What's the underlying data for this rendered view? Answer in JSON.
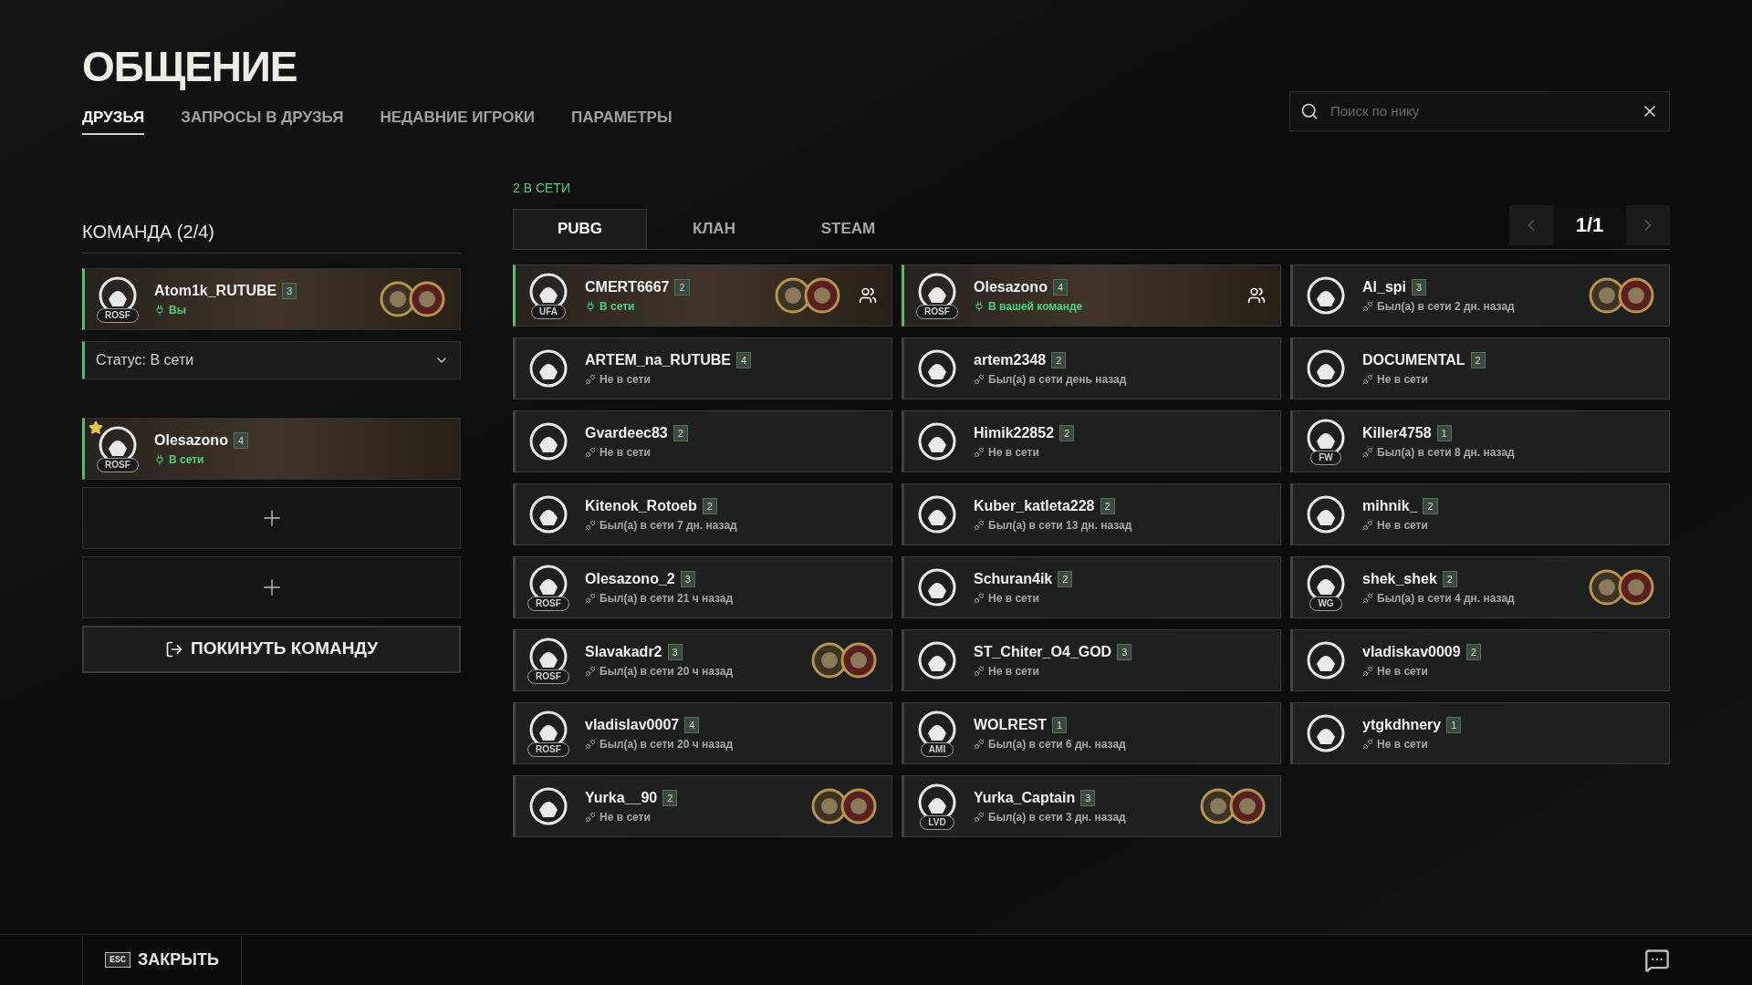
{
  "title": "ОБЩЕНИЕ",
  "nav_tabs": [
    {
      "label": "ДРУЗЬЯ",
      "selected": true
    },
    {
      "label": "ЗАПРОСЫ В ДРУЗЬЯ",
      "selected": false
    },
    {
      "label": "НЕДАВНИЕ ИГРОКИ",
      "selected": false
    },
    {
      "label": "ПАРАМЕТРЫ",
      "selected": false
    }
  ],
  "search": {
    "placeholder": "Поиск по нику"
  },
  "team": {
    "title": "КОМАНДА (2/4)",
    "status_select": {
      "value": "Статус: В сети"
    },
    "self": {
      "name": "Atom1k_RUTUBE",
      "level": "3",
      "clan": "ROSF",
      "status": "Вы",
      "online": true,
      "banner": true,
      "medals": true,
      "favorite": false
    },
    "members": [
      {
        "name": "Olesazono",
        "level": "4",
        "clan": "ROSF",
        "status": "В сети",
        "online": true,
        "banner": true,
        "medals": false,
        "favorite": true
      }
    ],
    "empty_slots": [
      {
        "kind": "add"
      },
      {
        "kind": "add"
      }
    ],
    "leave_button": "ПОКИНУТЬ КОМАНДУ"
  },
  "online_count": "2 В СЕТИ",
  "list_tabs": [
    {
      "label": "PUBG",
      "selected": true
    },
    {
      "label": "КЛАН",
      "selected": false
    },
    {
      "label": "STEAM",
      "selected": false
    }
  ],
  "pagination": {
    "page": "1/1"
  },
  "friends": [
    {
      "name": "CMERT6667",
      "level": "2",
      "clan": "UFA",
      "status": "В сети",
      "online": true,
      "banner": true,
      "medals": true,
      "invite": true
    },
    {
      "name": "Olesazono",
      "level": "4",
      "clan": "ROSF",
      "status": "В вашей команде",
      "online": true,
      "banner": true,
      "medals": false,
      "invite": true
    },
    {
      "name": "Al_spi",
      "level": "3",
      "status": "Был(а) в сети 2 дн. назад",
      "online": false,
      "banner": false,
      "medals": true,
      "invite": false
    },
    {
      "name": "ARTEM_na_RUTUBE",
      "level": "4",
      "status": "Не в сети",
      "online": false,
      "banner": false,
      "medals": false,
      "invite": false
    },
    {
      "name": "artem2348",
      "level": "2",
      "status": "Был(а) в сети день назад",
      "online": false,
      "banner": false,
      "medals": false,
      "invite": false
    },
    {
      "name": "DOCUMENTAL",
      "level": "2",
      "status": "Не в сети",
      "online": false,
      "banner": false,
      "medals": false,
      "invite": false
    },
    {
      "name": "Gvardeec83",
      "level": "2",
      "status": "Не в сети",
      "online": false,
      "banner": false,
      "medals": false,
      "invite": false
    },
    {
      "name": "Himik22852",
      "level": "2",
      "status": "Не в сети",
      "online": false,
      "banner": false,
      "medals": false,
      "invite": false
    },
    {
      "name": "Killer4758",
      "level": "1",
      "clan": "FW",
      "status": "Был(а) в сети 8 дн. назад",
      "online": false,
      "banner": false,
      "medals": false,
      "invite": false
    },
    {
      "name": "Kitenok_Rotoeb",
      "level": "2",
      "status": "Был(а) в сети 7 дн. назад",
      "online": false,
      "banner": false,
      "medals": false,
      "invite": false
    },
    {
      "name": "Kuber_katleta228",
      "level": "2",
      "status": "Был(а) в сети 13 дн. назад",
      "online": false,
      "banner": false,
      "medals": false,
      "invite": false
    },
    {
      "name": "mihnik_",
      "level": "2",
      "status": "Не в сети",
      "online": false,
      "banner": false,
      "medals": false,
      "invite": false
    },
    {
      "name": "Olesazono_2",
      "level": "3",
      "clan": "ROSF",
      "status": "Был(а) в сети 21 ч назад",
      "online": false,
      "banner": false,
      "medals": false,
      "invite": false
    },
    {
      "name": "Schuran4ik",
      "level": "2",
      "status": "Не в сети",
      "online": false,
      "banner": false,
      "medals": false,
      "invite": false
    },
    {
      "name": "shek_shek",
      "level": "2",
      "clan": "WG",
      "status": "Был(а) в сети 4 дн. назад",
      "online": false,
      "banner": false,
      "medals": true,
      "invite": false
    },
    {
      "name": "Slavakadr2",
      "level": "3",
      "clan": "ROSF",
      "status": "Был(а) в сети 20 ч назад",
      "online": false,
      "banner": false,
      "medals": true,
      "invite": false
    },
    {
      "name": "ST_Chiter_O4_GOD",
      "level": "3",
      "status": "Не в сети",
      "online": false,
      "banner": false,
      "medals": false,
      "invite": false
    },
    {
      "name": "vladiskav0009",
      "level": "2",
      "status": "Не в сети",
      "online": false,
      "banner": false,
      "medals": false,
      "invite": false
    },
    {
      "name": "vladislav0007",
      "level": "4",
      "clan": "ROSF",
      "status": "Был(а) в сети 20 ч назад",
      "online": false,
      "banner": false,
      "medals": false,
      "invite": false
    },
    {
      "name": "WOLREST",
      "level": "1",
      "clan": "AMI",
      "status": "Был(а) в сети 6 дн. назад",
      "online": false,
      "banner": false,
      "medals": false,
      "invite": false
    },
    {
      "name": "ytgkdhnery",
      "level": "1",
      "status": "Не в сети",
      "online": false,
      "banner": false,
      "medals": false,
      "invite": false
    },
    {
      "name": "Yurka__90",
      "level": "2",
      "status": "Не в сети",
      "online": false,
      "banner": false,
      "medals": true,
      "invite": false
    },
    {
      "name": "Yurka_Captain",
      "level": "3",
      "clan": "LVD",
      "status": "Был(а) в сети 3 дн. назад",
      "online": false,
      "banner": false,
      "medals": true,
      "invite": false
    }
  ],
  "footer": {
    "key": "ESC",
    "close": "ЗАКРЫТЬ"
  }
}
